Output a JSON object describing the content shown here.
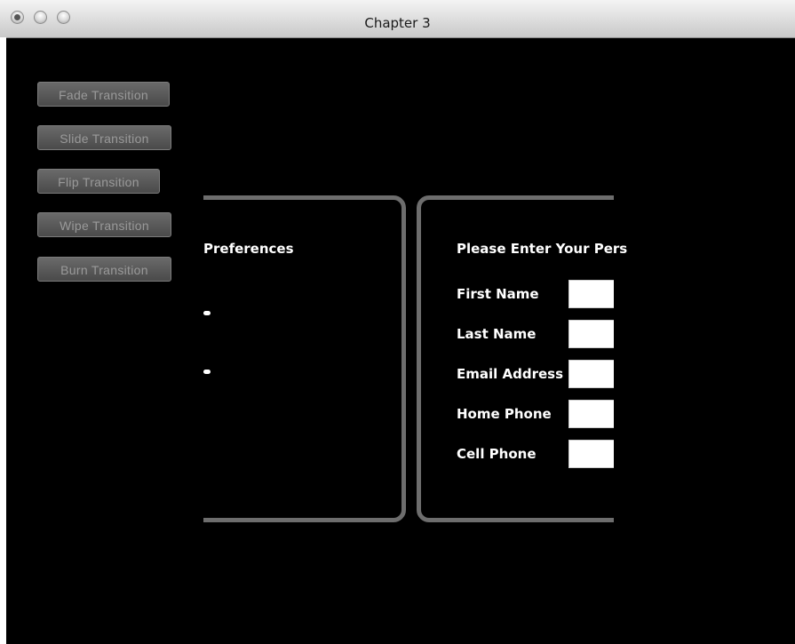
{
  "window": {
    "title": "Chapter 3"
  },
  "sidebar": {
    "buttons": [
      {
        "label": "Fade Transition"
      },
      {
        "label": "Slide Transition"
      },
      {
        "label": "Flip Transition"
      },
      {
        "label": "Wipe Transition"
      },
      {
        "label": "Burn Transition"
      }
    ]
  },
  "preferences_panel": {
    "title": "Preferences"
  },
  "personal_panel": {
    "title": "Please Enter Your Pers",
    "fields": [
      {
        "label": "First Name",
        "value": ""
      },
      {
        "label": "Last Name",
        "value": ""
      },
      {
        "label": "Email Address",
        "value": ""
      },
      {
        "label": "Home Phone",
        "value": ""
      },
      {
        "label": "Cell Phone",
        "value": ""
      }
    ]
  },
  "colors": {
    "background": "#000000",
    "panel_border": "#6d6d6d",
    "button_fill": "#555555",
    "button_text": "#9a9a9a",
    "label_text": "#ffffff"
  }
}
